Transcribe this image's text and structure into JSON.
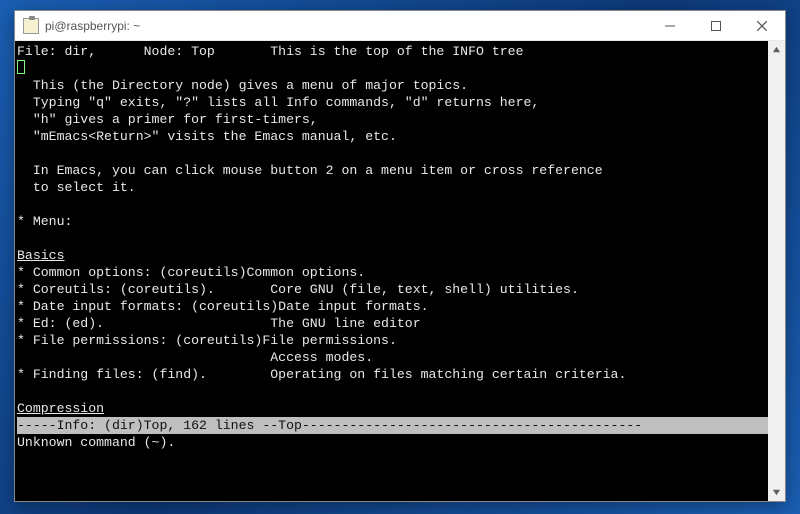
{
  "window": {
    "title": "pi@raspberrypi: ~"
  },
  "info": {
    "header": "File: dir,      Node: Top       This is the top of the INFO tree",
    "body_lines": [
      "  This (the Directory node) gives a menu of major topics.",
      "  Typing \"q\" exits, \"?\" lists all Info commands, \"d\" returns here,",
      "  \"h\" gives a primer for first-timers,",
      "  \"mEmacs<Return>\" visits the Emacs manual, etc.",
      "",
      "  In Emacs, you can click mouse button 2 on a menu item or cross reference",
      "  to select it.",
      "",
      "* Menu:"
    ],
    "section_basics": "Basics",
    "basics_lines": [
      "* Common options: (coreutils)Common options.",
      "* Coreutils: (coreutils).       Core GNU (file, text, shell) utilities.",
      "* Date input formats: (coreutils)Date input formats.",
      "* Ed: (ed).                     The GNU line editor",
      "* File permissions: (coreutils)File permissions.",
      "                                Access modes.",
      "* Finding files: (find).        Operating on files matching certain criteria.",
      ""
    ],
    "section_compression": "Compression",
    "status_line": "-----Info: (dir)Top, 162 lines --Top-------------------------------------------",
    "echo_line": "Unknown command (~)."
  }
}
